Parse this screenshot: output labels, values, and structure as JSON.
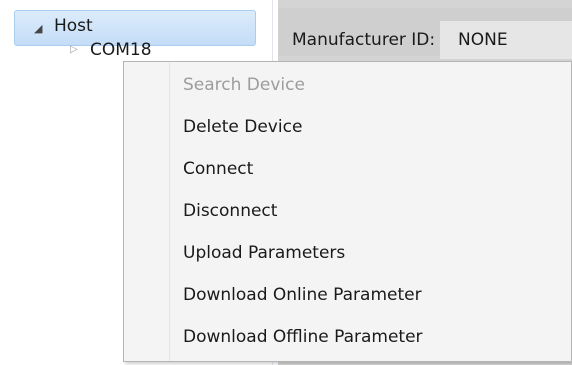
{
  "tree": {
    "host_label": "Host",
    "host_arrow_icon": "triangle-down-icon",
    "child_arrow_icon": "triangle-right-icon",
    "child_label": "COM18"
  },
  "right_panel": {
    "manufacturer_label": "Manufacturer ID:",
    "manufacturer_value": "NONE"
  },
  "context_menu": {
    "items": [
      {
        "label": "Search Device",
        "enabled": false
      },
      {
        "label": "Delete Device",
        "enabled": true
      },
      {
        "label": "Connect",
        "enabled": true
      },
      {
        "label": "Disconnect",
        "enabled": true
      },
      {
        "label": "Upload Parameters",
        "enabled": true
      },
      {
        "label": "Download Online Parameter",
        "enabled": true
      },
      {
        "label": "Download Offline Parameter",
        "enabled": true
      }
    ]
  },
  "colors": {
    "selection_bg": "#c4ddf7",
    "selection_border": "#a8cdf0",
    "menu_bg": "#f4f4f4",
    "disabled_text": "#9c9c9c",
    "panel_bg": "#d4d4d4"
  }
}
